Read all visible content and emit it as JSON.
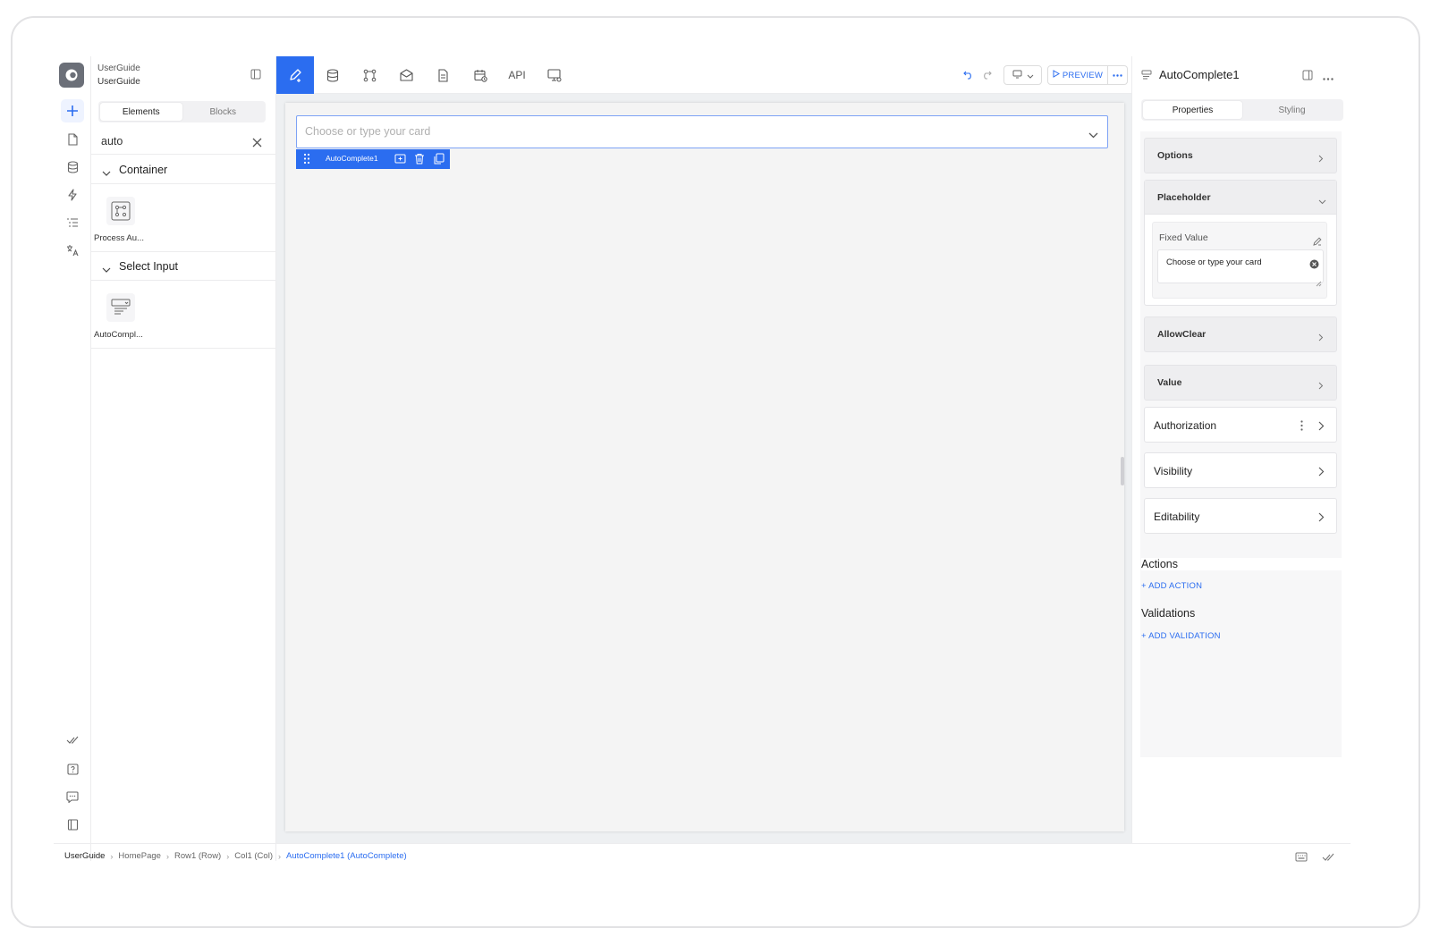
{
  "project": {
    "line1": "UserGuide",
    "line2": "UserGuide"
  },
  "left_panel": {
    "tabs": [
      "Elements",
      "Blocks"
    ],
    "active_tab": "Elements",
    "search_value": "auto",
    "groups": [
      {
        "title": "Container",
        "items": [
          {
            "label": "Process Au...",
            "icon": "process-icon"
          }
        ]
      },
      {
        "title": "Select Input",
        "items": [
          {
            "label": "AutoCompl...",
            "icon": "select-input-icon"
          }
        ]
      }
    ]
  },
  "rail_icons": [
    "plus-icon",
    "page-icon",
    "database-icon",
    "lightning-icon",
    "list-icon",
    "translate-icon",
    "checks-icon",
    "help-icon",
    "chat-icon",
    "book-icon"
  ],
  "toolbar": {
    "items": [
      "edit-icon",
      "database-icon",
      "workflow-icon",
      "mail-icon",
      "document-icon",
      "calendar-icon",
      "API",
      "screen-settings-icon"
    ],
    "api_label": "API",
    "preview_label": "PREVIEW"
  },
  "canvas": {
    "autocomplete_placeholder": "Choose or type your card",
    "selected_component": "AutoComplete1"
  },
  "breadcrumb": {
    "items": [
      "UserGuide",
      "HomePage",
      "Row1 (Row)",
      "Col1 (Col)"
    ],
    "current": "AutoComplete1 (AutoComplete)"
  },
  "right_panel": {
    "title": "AutoComplete1",
    "tabs": [
      "Properties",
      "Styling"
    ],
    "active_tab": "Properties",
    "sections": {
      "options": "Options",
      "placeholder": "Placeholder",
      "fixed_value_label": "Fixed Value",
      "fixed_value": "Choose or type your card",
      "allow_clear": "AllowClear",
      "value": "Value",
      "authorization": "Authorization",
      "visibility": "Visibility",
      "editability": "Editability"
    },
    "actions_title": "Actions",
    "add_action": "+ ADD ACTION",
    "validations_title": "Validations",
    "add_validation": "+ ADD VALIDATION"
  },
  "colors": {
    "accent": "#2b6df0",
    "canvas_bg": "#f4f4f4",
    "panel_border": "#ececee"
  }
}
